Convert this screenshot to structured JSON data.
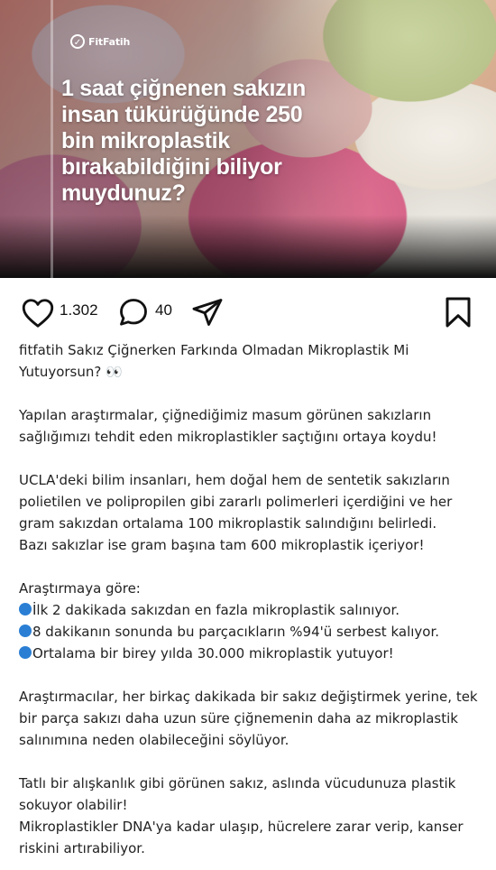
{
  "hero": {
    "logo_text": "FitFatih",
    "headline": "1 saat çiğnenen sakızın insan tükürüğünde 250 bin mikroplastik bırakabildiğini biliyor muydunuz?"
  },
  "actions": {
    "like_count": "1.302",
    "comment_count": "40"
  },
  "caption": {
    "username": "fitfatih",
    "title": "Sakız Çiğnerken Farkında Olmadan Mikroplastik Mi Yutuyorsun? 👀",
    "p1": "Yapılan araştırmalar, çiğnediğimiz masum görünen sakızların sağlığımızı tehdit eden mikroplastikler saçtığını ortaya koydu!",
    "p2": "UCLA'deki bilim insanları, hem doğal hem de sentetik sakızların polietilen ve polipropilen gibi zararlı polimerleri içerdiğini ve her gram sakızdan ortalama 100 mikroplastik salındığını belirledi.",
    "p3": "Bazı sakızlar ise gram başına tam 600 mikroplastik içeriyor!",
    "list_heading": "Araştırmaya göre:",
    "bullets": [
      "İlk 2 dakikada sakızdan en fazla mikroplastik salınıyor.",
      "8 dakikanın sonunda bu parçacıkların %94'ü serbest kalıyor.",
      "Ortalama bir birey yılda 30.000 mikroplastik yutuyor!"
    ],
    "p4": "Araştırmacılar, her birkaç dakikada bir sakız değiştirmek yerine, tek bir parça sakızı daha uzun süre çiğnemenin daha az mikroplastik salınımına neden olabileceğini söylüyor.",
    "p5": "Tatlı bir alışkanlık gibi görünen sakız, aslında vücudunuza plastik sokuyor olabilir!",
    "p6": "Mikroplastikler DNA'ya kadar ulaşıp, hücrelere zarar verip, kanser riskini artırabiliyor."
  },
  "colors": {
    "bullet": "#2a7fd4",
    "text": "#222222"
  }
}
